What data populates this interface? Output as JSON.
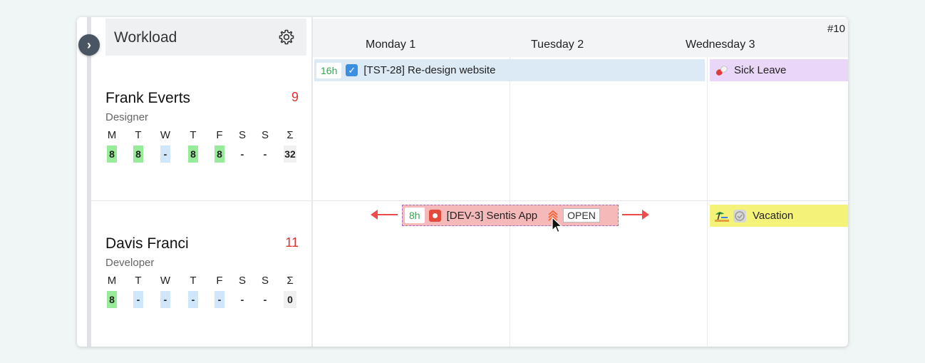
{
  "panel": {
    "title": "Workload",
    "week_label": "#10",
    "days": [
      "Monday 1",
      "Tuesday 2",
      "Wednesday 3"
    ],
    "weekday_headers": [
      "M",
      "T",
      "W",
      "T",
      "F",
      "S",
      "S",
      "Σ"
    ]
  },
  "users": [
    {
      "name": "Frank Everts",
      "role": "Designer",
      "count": "9",
      "values": [
        "8",
        "8",
        "-",
        "8",
        "8",
        "-",
        "-",
        "32"
      ]
    },
    {
      "name": "Davis Franci",
      "role": "Developer",
      "count": "11",
      "values": [
        "8",
        "-",
        "-",
        "-",
        "-",
        "-",
        "-",
        "0"
      ]
    }
  ],
  "events": {
    "task1": {
      "hours": "16h",
      "title": "[TST-28] Re-design website",
      "icon": "checkbox-icon"
    },
    "sick": {
      "title": "Sick Leave",
      "icon": "pill-icon"
    },
    "task2": {
      "hours": "8h",
      "title": "[DEV-3] Sentis App",
      "status": "OPEN",
      "icon": "bug-icon",
      "priority_icon": "highest-priority-icon"
    },
    "vacation": {
      "title": "Vacation",
      "icon": "beach-icon"
    }
  },
  "colors": {
    "task1_bg": "#dbeaf4",
    "sick_bg": "#ead6f7",
    "task2_bg": "#f6b9b9",
    "vacation_bg": "#f5f27a",
    "hours_green": "#2fa84f",
    "count_red": "#e03030",
    "cell_green": "#98eb98",
    "cell_blue": "#cfe6fb"
  }
}
